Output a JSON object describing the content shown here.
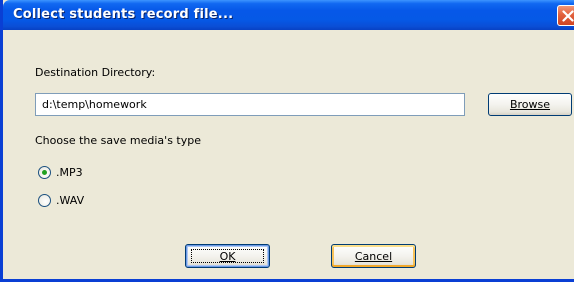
{
  "window": {
    "title": "Collect students record file..."
  },
  "destination": {
    "label": "Destination Directory:",
    "value": "d:\\temp\\homework",
    "browse_label": "Browse"
  },
  "media": {
    "prompt": "Choose the save media's type",
    "options": [
      {
        "label": ".MP3",
        "selected": true
      },
      {
        "label": ".WAV",
        "selected": false
      }
    ]
  },
  "buttons": {
    "ok_label": "OK",
    "cancel_label": "Cancel"
  },
  "colors": {
    "titlebar": "#0658e8",
    "dialog_bg": "#ece9d8",
    "radio_selected": "#21a121",
    "close_button": "#e2613d"
  }
}
